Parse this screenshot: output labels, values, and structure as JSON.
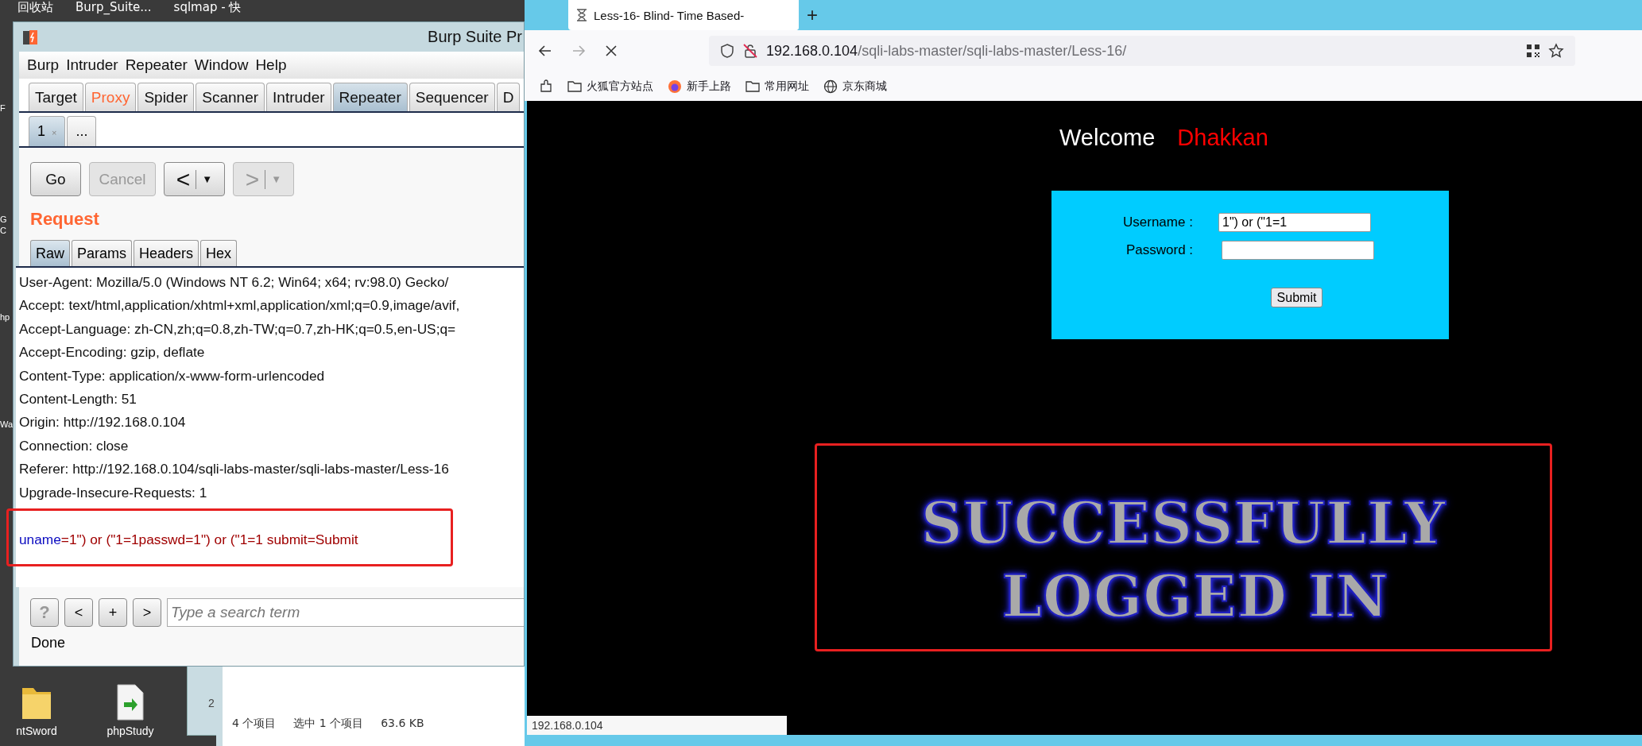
{
  "desktop": {
    "top_labels": [
      "回收站",
      "Burp_Suite...",
      "sqlmap - 快"
    ],
    "edge_fragments": [
      "F",
      "G",
      "C",
      "hp",
      "Wa"
    ],
    "bottom_icons": [
      {
        "kind": "folder",
        "label": "ntSword"
      },
      {
        "kind": "file",
        "label": "phpStudy"
      }
    ]
  },
  "burp": {
    "title": "Burp Suite Pr",
    "menu": [
      "Burp",
      "Intruder",
      "Repeater",
      "Window",
      "Help"
    ],
    "tabs": [
      {
        "label": "Target",
        "selected": false,
        "highlighted": false
      },
      {
        "label": "Proxy",
        "selected": false,
        "highlighted": true
      },
      {
        "label": "Spider",
        "selected": false,
        "highlighted": false
      },
      {
        "label": "Scanner",
        "selected": false,
        "highlighted": false
      },
      {
        "label": "Intruder",
        "selected": false,
        "highlighted": false
      },
      {
        "label": "Repeater",
        "selected": true,
        "highlighted": false
      },
      {
        "label": "Sequencer",
        "selected": false,
        "highlighted": false
      },
      {
        "label": "D",
        "selected": false,
        "highlighted": false
      }
    ],
    "subtabs": [
      {
        "label": "1",
        "close": "×",
        "selected": true
      },
      {
        "label": "...",
        "selected": false
      }
    ],
    "buttons": [
      {
        "kind": "text",
        "label": "Go",
        "disabled": false
      },
      {
        "kind": "text",
        "label": "Cancel",
        "disabled": true
      },
      {
        "kind": "split",
        "label": "<",
        "caret": "▼",
        "disabled": false
      },
      {
        "kind": "split",
        "label": ">",
        "caret": "▼",
        "disabled": true
      }
    ],
    "section_title": "Request",
    "request_tabs": [
      {
        "label": "Raw",
        "selected": true
      },
      {
        "label": "Params",
        "selected": false
      },
      {
        "label": "Headers",
        "selected": false
      },
      {
        "label": "Hex",
        "selected": false
      }
    ],
    "request_lines": [
      "User-Agent: Mozilla/5.0 (Windows NT 6.2; Win64; x64; rv:98.0) Gecko/",
      "Accept: text/html,application/xhtml+xml,application/xml;q=0.9,image/avif,",
      "Accept-Language: zh-CN,zh;q=0.8,zh-TW;q=0.7,zh-HK;q=0.5,en-US;q=",
      "Accept-Encoding: gzip, deflate",
      "Content-Type: application/x-www-form-urlencoded",
      "Content-Length: 51",
      "Origin: http://192.168.0.104",
      "Connection: close",
      "Referer: http://192.168.0.104/sqli-labs-master/sqli-labs-master/Less-16",
      "Upgrade-Insecure-Requests: 1"
    ],
    "request_body": [
      {
        "kind": "key",
        "text": "uname"
      },
      {
        "kind": "value",
        "text": "=1\") or (\"1=1passwd=1\") or (\"1=1 submit=Submit"
      }
    ],
    "search_buttons": [
      {
        "label": "?",
        "disabled": true
      },
      {
        "label": "<",
        "disabled": false
      },
      {
        "label": "+",
        "disabled": false
      },
      {
        "label": ">",
        "disabled": false
      }
    ],
    "search": {
      "placeholder": "Type a search term"
    },
    "status": "Done"
  },
  "explorer": {
    "side_text": "2",
    "status": [
      "4 个项目",
      "选中 1 个项目",
      "63.6 KB"
    ]
  },
  "browser": {
    "tab": {
      "title": "Less-16- Blind- Time Based-"
    },
    "new_tab": "+",
    "url": {
      "host": "192.168.0.104",
      "path": "/sqli-labs-master/sqli-labs-master/Less-16/"
    },
    "bookmarks": [
      {
        "kind": "folder",
        "label": "火狐官方站点"
      },
      {
        "kind": "firefox",
        "label": "新手上路"
      },
      {
        "kind": "folder",
        "label": "常用网址"
      },
      {
        "kind": "globe",
        "label": "京东商城"
      }
    ],
    "page": {
      "welcome": "Welcome",
      "name": "Dhakkan",
      "form": {
        "username_label": "Username :",
        "username_value": "1\") or (\"1=1",
        "password_label": "Password :",
        "submit": "Submit"
      },
      "banner": [
        "SUCCESSFULLY",
        "LOGGED IN"
      ]
    },
    "status_url": "192.168.0.104"
  }
}
